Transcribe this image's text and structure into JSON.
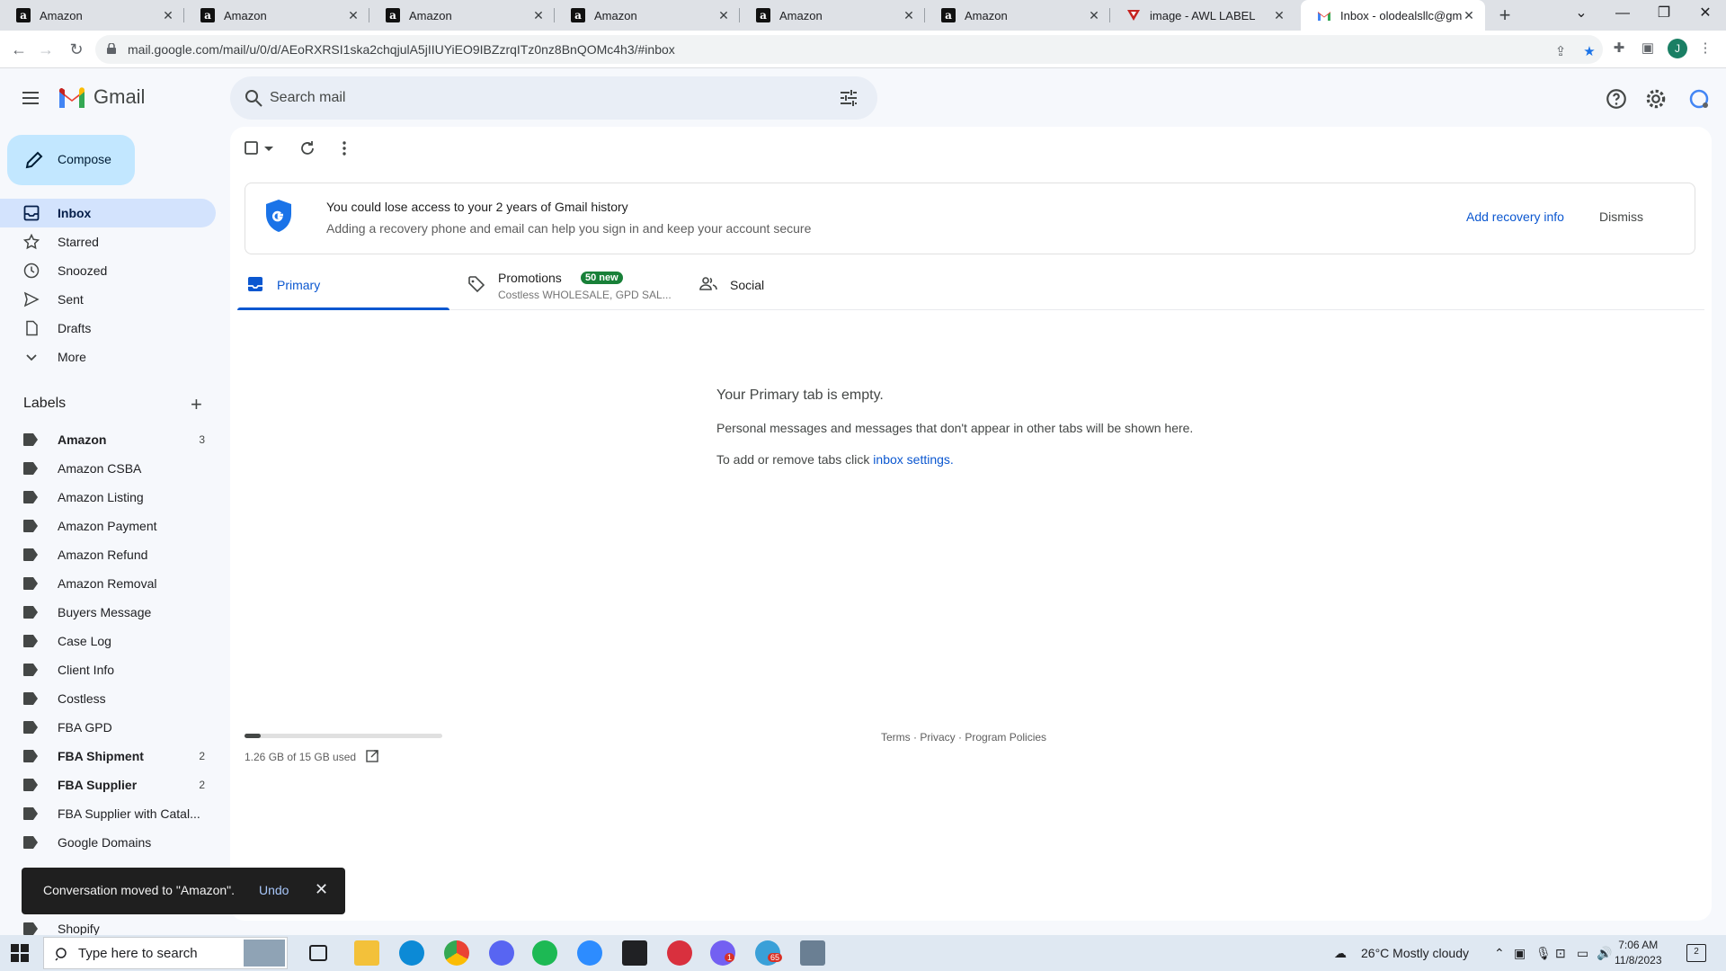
{
  "browser": {
    "tabs": [
      {
        "title": "Amazon",
        "favicon": "amazon-favicon"
      },
      {
        "title": "Amazon",
        "favicon": "amazon-favicon"
      },
      {
        "title": "Amazon",
        "favicon": "amazon-favicon"
      },
      {
        "title": "Amazon",
        "favicon": "amazon-favicon"
      },
      {
        "title": "Amazon",
        "favicon": "amazon-favicon"
      },
      {
        "title": "Amazon",
        "favicon": "amazon-favicon"
      },
      {
        "title": "image - AWL LABEL",
        "favicon": "drive-favicon"
      },
      {
        "title": "Inbox - olodealsllc@gmai",
        "favicon": "gmail-favicon",
        "active": true
      }
    ],
    "url": "mail.google.com/mail/u/0/d/AEoRXRSI1ska2chqjulA5jIIUYiEO9IBZzrqITz0nz8BnQOMc4h3/#inbox",
    "profile_initial": "J"
  },
  "gmail": {
    "brand": "Gmail",
    "search_placeholder": "Search mail",
    "compose_label": "Compose",
    "nav": [
      {
        "label": "Inbox",
        "icon": "inbox-icon",
        "active": true
      },
      {
        "label": "Starred",
        "icon": "star-icon"
      },
      {
        "label": "Snoozed",
        "icon": "clock-icon"
      },
      {
        "label": "Sent",
        "icon": "send-icon"
      },
      {
        "label": "Drafts",
        "icon": "draft-icon"
      },
      {
        "label": "More",
        "icon": "chevron-down-icon"
      }
    ],
    "labels_heading": "Labels",
    "labels": [
      {
        "label": "Amazon",
        "count": "3",
        "bold": true
      },
      {
        "label": "Amazon CSBA",
        "count": ""
      },
      {
        "label": "Amazon Listing",
        "count": ""
      },
      {
        "label": "Amazon Payment",
        "count": ""
      },
      {
        "label": "Amazon Refund",
        "count": ""
      },
      {
        "label": "Amazon Removal",
        "count": ""
      },
      {
        "label": "Buyers Message",
        "count": ""
      },
      {
        "label": "Case Log",
        "count": ""
      },
      {
        "label": "Client Info",
        "count": ""
      },
      {
        "label": "Costless",
        "count": ""
      },
      {
        "label": "FBA GPD",
        "count": ""
      },
      {
        "label": "FBA Shipment",
        "count": "2",
        "bold": true
      },
      {
        "label": "FBA Supplier",
        "count": "2",
        "bold": true
      },
      {
        "label": "FBA Supplier with Catal...",
        "count": ""
      },
      {
        "label": "Google Domains",
        "count": ""
      },
      {
        "label": "Shopify",
        "count": ""
      }
    ],
    "banner": {
      "title": "You could lose access to your 2 years of Gmail history",
      "subtitle": "Adding a recovery phone and email can help you sign in and keep your account secure",
      "action": "Add recovery info",
      "dismiss": "Dismiss"
    },
    "inbox_tabs": [
      {
        "label": "Primary",
        "icon": "inbox-icon",
        "active": true
      },
      {
        "label": "Promotions",
        "icon": "tag-icon",
        "badge": "50 new",
        "snippet": "Costless WHOLESALE, GPD SAL..."
      },
      {
        "label": "Social",
        "icon": "people-icon"
      }
    ],
    "empty_state": {
      "title": "Your Primary tab is empty.",
      "line1": "Personal messages and messages that don't appear in other tabs will be shown here.",
      "line2_prefix": "To add or remove tabs click ",
      "line2_link": "inbox settings",
      "line2_suffix": "."
    },
    "storage": {
      "text": "1.26 GB of 15 GB used",
      "fraction": 0.084
    },
    "footer": {
      "terms": "Terms",
      "privacy": "Privacy",
      "policies": "Program Policies",
      "sep": " · "
    },
    "snackbar": {
      "message": "Conversation moved to \"Amazon\".",
      "undo": "Undo"
    }
  },
  "taskbar": {
    "search_placeholder": "Type here to search",
    "weather": "26°C  Mostly cloudy",
    "time": "7:06 AM",
    "date": "11/8/2023",
    "notification_count": "2",
    "spotify_badge": "",
    "app_badges": [
      "1",
      "65"
    ]
  },
  "colors": {
    "accent": "#0b57d0",
    "active_nav": "#d3e3fd",
    "compose": "#c2e7ff",
    "badge_green": "#188038"
  }
}
